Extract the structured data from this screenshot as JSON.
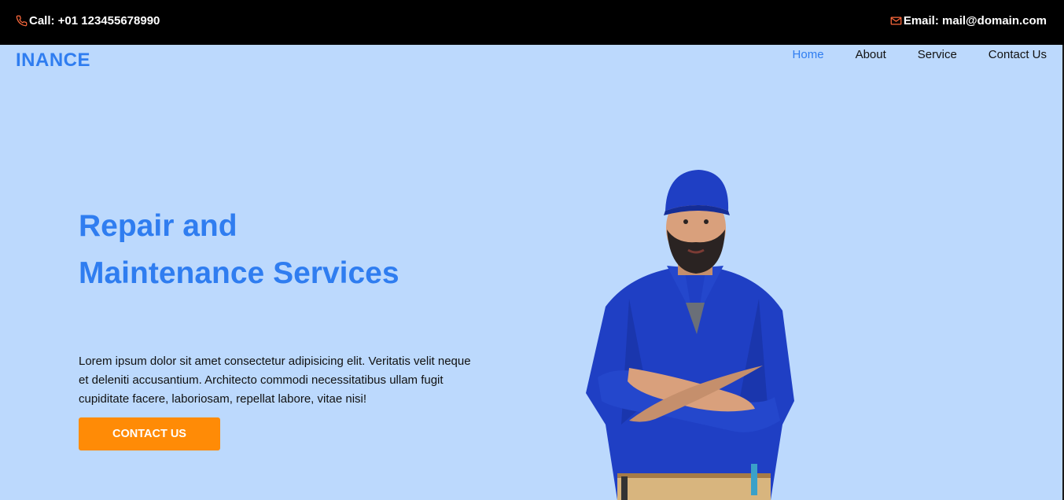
{
  "topbar": {
    "call_text": "Call: +01 123455678990",
    "email_text": "Email: mail@domain.com",
    "call_icon": "phone-icon",
    "email_icon": "mail-icon",
    "icon_color": "#ff6a3d"
  },
  "nav": {
    "brand": "INANCE",
    "links": [
      "Home",
      "About",
      "Service",
      "Contact Us"
    ],
    "active": "Home"
  },
  "hero": {
    "title": "Repair and Maintenance Services",
    "text": "Lorem ipsum dolor sit amet consectetur adipisicing elit. Veritatis velit neque et deleniti accusantium. Architecto commodi necessitatibus ullam fugit cupiditate facere, laboriosam, repellat labore, vitae nisi!",
    "cta_label": "CONTACT US",
    "image": "repairman-photo"
  },
  "colors": {
    "accent": "#2f7df0",
    "background": "#bcd9fd",
    "cta": "#ff8b06",
    "topbar": "#000000"
  }
}
